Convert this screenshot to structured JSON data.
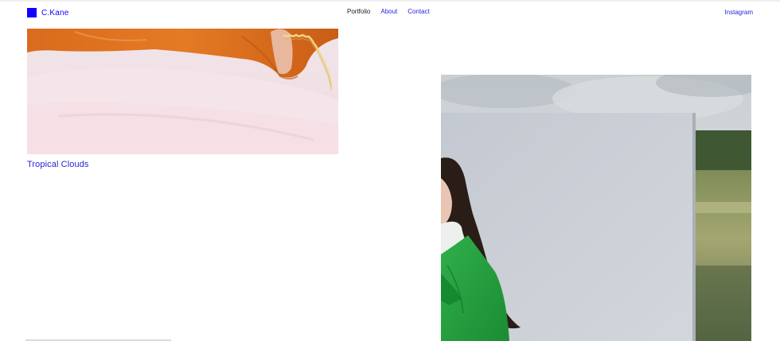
{
  "brand": {
    "name": "C.Kane",
    "color": "#1400ff"
  },
  "nav": {
    "items": [
      {
        "label": "Portfolio",
        "color": "#222222"
      },
      {
        "label": "About",
        "color": "#2a22d6"
      },
      {
        "label": "Contact",
        "color": "#2a22d6"
      }
    ]
  },
  "social": {
    "label": "Instagram",
    "color": "#2a22d6"
  },
  "projects": [
    {
      "title": "Tropical Clouds",
      "title_color": "#2a22d6",
      "image_icon": "bedroom-phone-photo"
    },
    {
      "title": "",
      "image_icon": "green-jacket-portrait-photo"
    }
  ]
}
